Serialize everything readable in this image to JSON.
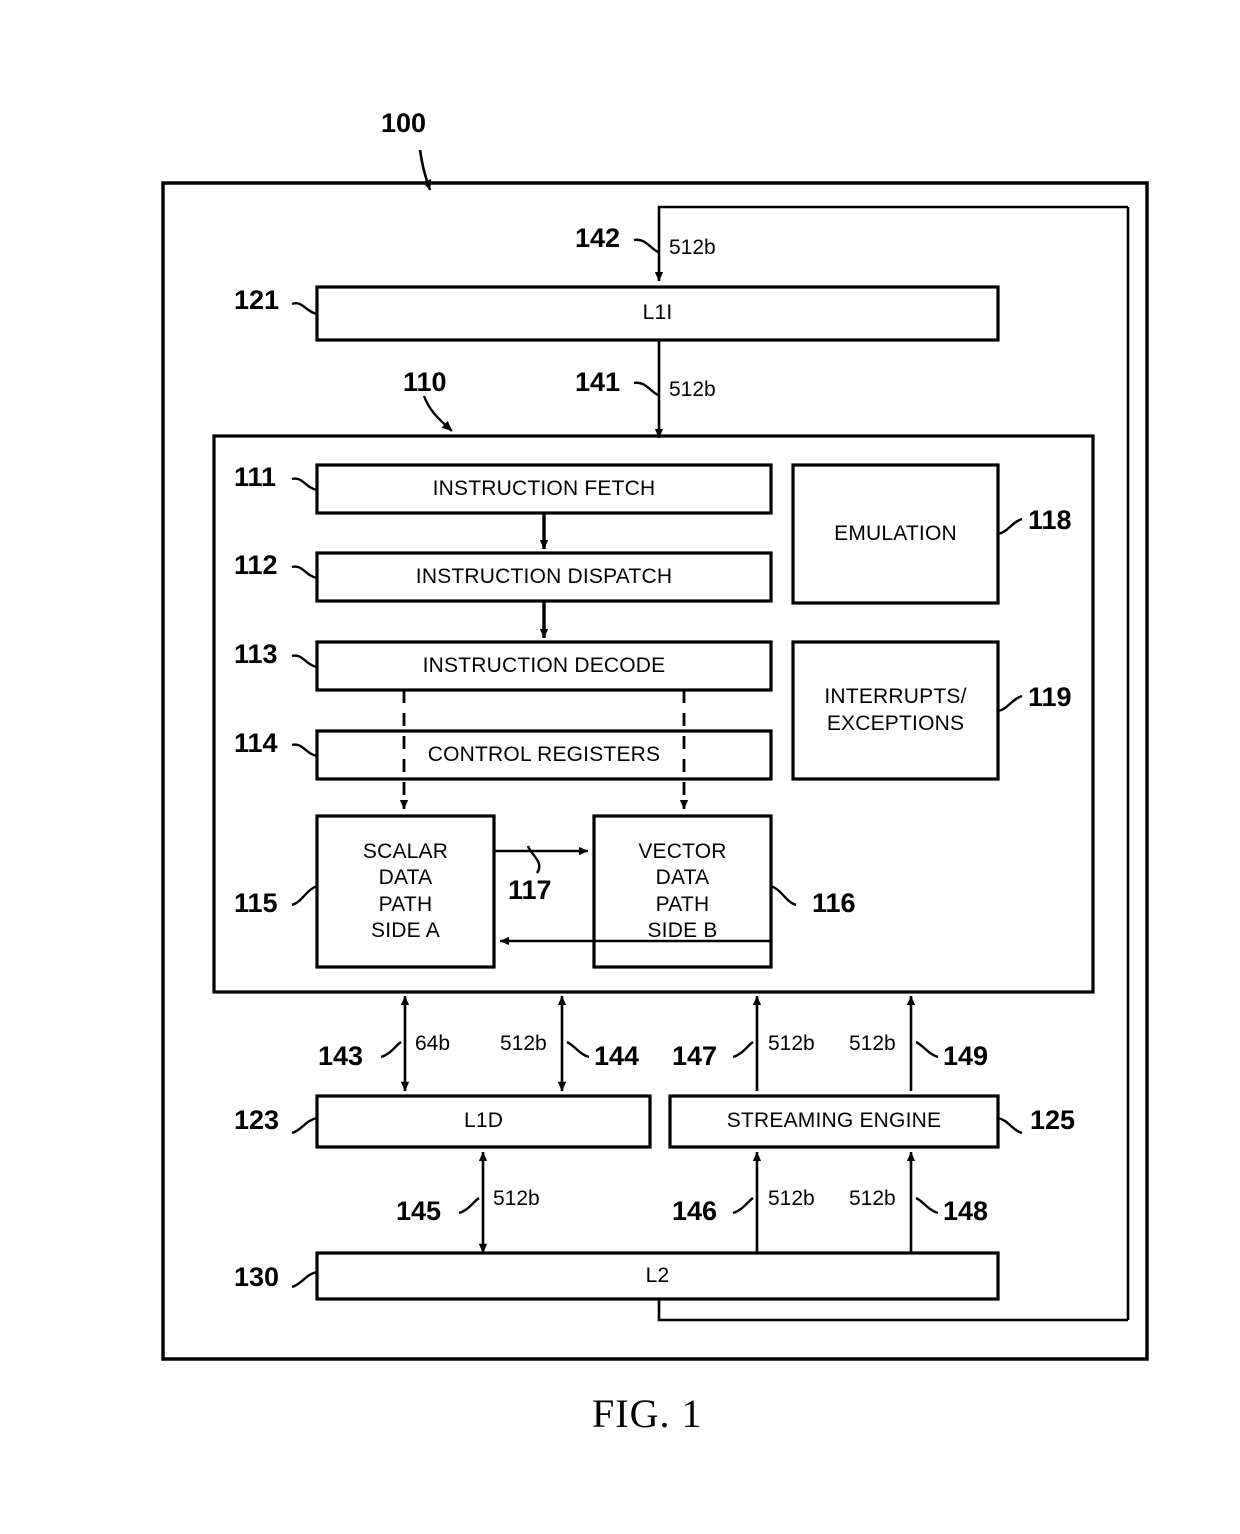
{
  "figure": {
    "caption": "FIG. 1",
    "top_ref": "100"
  },
  "blocks": [
    {
      "id": "l1i",
      "label": "L1I",
      "ref": "121"
    },
    {
      "id": "instruction-fetch",
      "label": "INSTRUCTION FETCH",
      "ref": "111"
    },
    {
      "id": "instruction-dispatch",
      "label": "INSTRUCTION DISPATCH",
      "ref": "112"
    },
    {
      "id": "instruction-decode",
      "label": "INSTRUCTION DECODE",
      "ref": "113"
    },
    {
      "id": "control-registers",
      "label": "CONTROL REGISTERS",
      "ref": "114"
    },
    {
      "id": "scalar-data-path",
      "label": "SCALAR DATA PATH SIDE A",
      "ref": "115",
      "lines": [
        "SCALAR",
        "DATA",
        "PATH",
        "SIDE A"
      ]
    },
    {
      "id": "vector-data-path",
      "label": "VECTOR DATA PATH SIDE B",
      "ref": "116",
      "lines": [
        "VECTOR",
        "DATA",
        "PATH",
        "SIDE B"
      ]
    },
    {
      "id": "emulation",
      "label": "EMULATION",
      "ref": "118"
    },
    {
      "id": "interrupts-exceptions",
      "label": "INTERRUPTS/ EXCEPTIONS",
      "ref": "119",
      "lines": [
        "INTERRUPTS/",
        "EXCEPTIONS"
      ]
    },
    {
      "id": "l1d",
      "label": "L1D",
      "ref": "123"
    },
    {
      "id": "streaming-engine",
      "label": "STREAMING ENGINE",
      "ref": "125"
    },
    {
      "id": "l2",
      "label": "L2",
      "ref": "130"
    }
  ],
  "groups": {
    "processor": {
      "ref": "100"
    },
    "central_processing_unit": {
      "ref": "110"
    }
  },
  "connections": [
    {
      "ref": "141",
      "width": "512b",
      "from": "l1i",
      "to": "cpu-core"
    },
    {
      "ref": "142",
      "width": "512b",
      "from": "l2-feedback",
      "to": "l1i"
    },
    {
      "ref": "143",
      "width": "64b",
      "from": "cpu-core",
      "to": "l1d"
    },
    {
      "ref": "144",
      "width": "512b",
      "from": "cpu-core",
      "to": "l1d"
    },
    {
      "ref": "145",
      "width": "512b",
      "from": "l2",
      "to": "l1d"
    },
    {
      "ref": "146",
      "width": "512b",
      "from": "l2",
      "to": "streaming-engine"
    },
    {
      "ref": "147",
      "width": "512b",
      "from": "streaming-engine",
      "to": "cpu-core"
    },
    {
      "ref": "148",
      "width": "512b",
      "from": "l2",
      "to": "streaming-engine"
    },
    {
      "ref": "149",
      "width": "512b",
      "from": "streaming-engine",
      "to": "cpu-core"
    },
    {
      "ref": "117",
      "width": "",
      "from": "scalar-data-path",
      "to": "vector-data-path"
    }
  ],
  "colors": {
    "stroke": "#000000",
    "background": "#ffffff"
  }
}
